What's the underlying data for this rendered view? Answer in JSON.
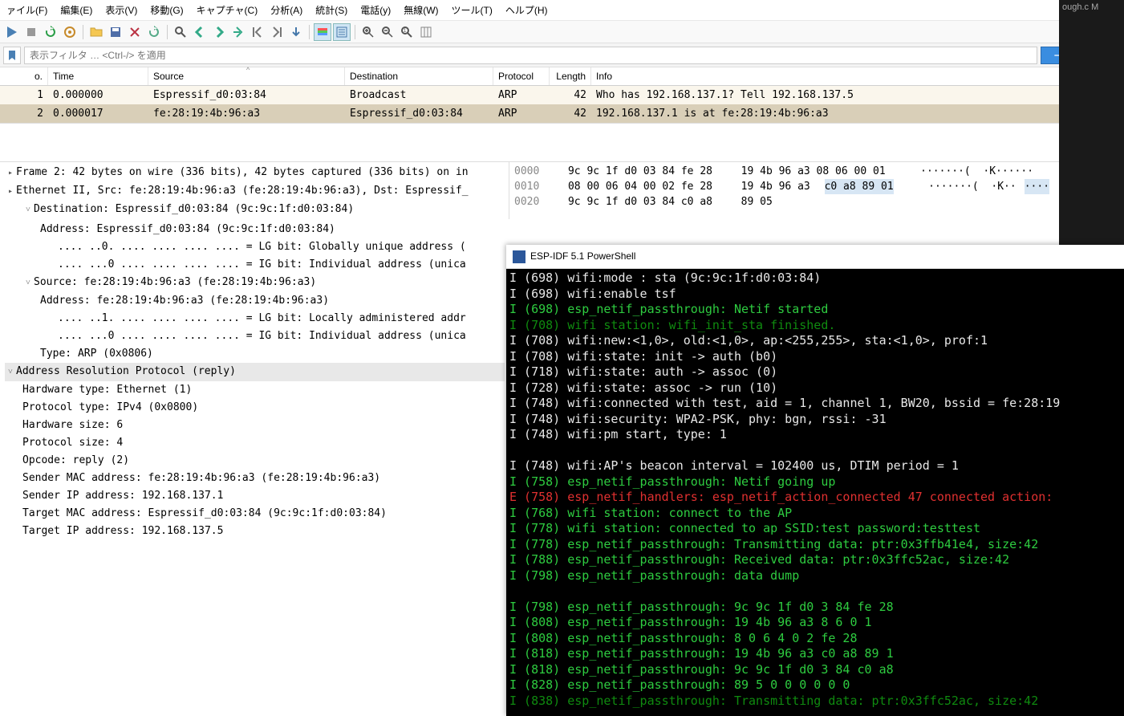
{
  "menu": [
    "ァイル(F)",
    "編集(E)",
    "表示(V)",
    "移動(G)",
    "キャプチャ(C)",
    "分析(A)",
    "統計(S)",
    "電話(y)",
    "無線(W)",
    "ツール(T)",
    "ヘルプ(H)"
  ],
  "filter_placeholder": "表示フィルタ … <Ctrl-/> を適用",
  "table_headers": {
    "no": "o.",
    "time": "Time",
    "source": "Source",
    "destination": "Destination",
    "protocol": "Protocol",
    "length": "Length",
    "info": "Info"
  },
  "packets": [
    {
      "no": "1",
      "time": "0.000000",
      "src": "Espressif_d0:03:84",
      "dst": "Broadcast",
      "prot": "ARP",
      "len": "42",
      "info": "Who has 192.168.137.1? Tell 192.168.137.5"
    },
    {
      "no": "2",
      "time": "0.000017",
      "src": "fe:28:19:4b:96:a3",
      "dst": "Espressif_d0:03:84",
      "prot": "ARP",
      "len": "42",
      "info": "192.168.137.1 is at fe:28:19:4b:96:a3"
    }
  ],
  "details": {
    "frame": "Frame 2: 42 bytes on wire (336 bits), 42 bytes captured (336 bits) on in",
    "eth": "Ethernet II, Src: fe:28:19:4b:96:a3 (fe:28:19:4b:96:a3), Dst: Espressif_",
    "dest_hdr": "Destination: Espressif_d0:03:84 (9c:9c:1f:d0:03:84)",
    "dest_addr": "Address: Espressif_d0:03:84 (9c:9c:1f:d0:03:84)",
    "dest_lg": ".... ..0. .... .... .... .... = LG bit: Globally unique address (",
    "dest_ig": ".... ...0 .... .... .... .... = IG bit: Individual address (unica",
    "src_hdr": "Source: fe:28:19:4b:96:a3 (fe:28:19:4b:96:a3)",
    "src_addr": "Address: fe:28:19:4b:96:a3 (fe:28:19:4b:96:a3)",
    "src_lg": ".... ..1. .... .... .... .... = LG bit: Locally administered addr",
    "src_ig": ".... ...0 .... .... .... .... = IG bit: Individual address (unica",
    "type": "Type: ARP (0x0806)",
    "arp_hdr": "Address Resolution Protocol (reply)",
    "arp": [
      "Hardware type: Ethernet (1)",
      "Protocol type: IPv4 (0x0800)",
      "Hardware size: 6",
      "Protocol size: 4",
      "Opcode: reply (2)",
      "Sender MAC address: fe:28:19:4b:96:a3 (fe:28:19:4b:96:a3)",
      "Sender IP address: 192.168.137.1",
      "Target MAC address: Espressif_d0:03:84 (9c:9c:1f:d0:03:84)",
      "Target IP address: 192.168.137.5"
    ]
  },
  "hex_rows": [
    {
      "off": "0000",
      "b1": "9c 9c 1f d0 03 84 fe 28",
      "b2": "19 4b 96 a3 08 06 00 01",
      "asc": "·······(  ·K······"
    },
    {
      "off": "0010",
      "b1": "08 00 06 04 00 02 fe 28",
      "b2": "19 4b 96 a3 ",
      "b2hi": "c0 a8 89 01",
      "asc": "·······(  ·K··",
      "aschi": "····"
    },
    {
      "off": "0020",
      "b1": "9c 9c 1f d0 03 84 c0 a8",
      "b2": "89 05",
      "asc": ""
    }
  ],
  "ps_title": "ESP-IDF 5.1 PowerShell",
  "ps_lines": [
    {
      "c": "white",
      "t": "I (698) wifi:mode : sta (9c:9c:1f:d0:03:84)"
    },
    {
      "c": "white",
      "t": "I (698) wifi:enable tsf"
    },
    {
      "c": "green",
      "t": "I (698) esp_netif_passthrough: Netif started"
    },
    {
      "c": "dgreen",
      "t": "I (708) wifi station: wifi_init_sta finished."
    },
    {
      "c": "white",
      "t": "I (708) wifi:new:<1,0>, old:<1,0>, ap:<255,255>, sta:<1,0>, prof:1"
    },
    {
      "c": "white",
      "t": "I (708) wifi:state: init -> auth (b0)"
    },
    {
      "c": "white",
      "t": "I (718) wifi:state: auth -> assoc (0)"
    },
    {
      "c": "white",
      "t": "I (728) wifi:state: assoc -> run (10)"
    },
    {
      "c": "white",
      "t": "I (748) wifi:connected with test, aid = 1, channel 1, BW20, bssid = fe:28:19"
    },
    {
      "c": "white",
      "t": "I (748) wifi:security: WPA2-PSK, phy: bgn, rssi: -31"
    },
    {
      "c": "white",
      "t": "I (748) wifi:pm start, type: 1"
    },
    {
      "c": "white",
      "t": ""
    },
    {
      "c": "white",
      "t": "I (748) wifi:AP's beacon interval = 102400 us, DTIM period = 1"
    },
    {
      "c": "green",
      "t": "I (758) esp_netif_passthrough: Netif going up"
    },
    {
      "c": "red",
      "t": "E (758) esp_netif_handlers: esp_netif_action_connected 47 connected action:"
    },
    {
      "c": "green",
      "t": "I (768) wifi station: connect to the AP"
    },
    {
      "c": "green",
      "t": "I (778) wifi station: connected to ap SSID:test password:testtest"
    },
    {
      "c": "green",
      "t": "I (778) esp_netif_passthrough: Transmitting data: ptr:0x3ffb41e4, size:42"
    },
    {
      "c": "green",
      "t": "I (788) esp_netif_passthrough: Received data: ptr:0x3ffc52ac, size:42"
    },
    {
      "c": "green",
      "t": "I (798) esp_netif_passthrough: data dump"
    },
    {
      "c": "white",
      "t": ""
    },
    {
      "c": "green",
      "t": "I (798) esp_netif_passthrough: 9c 9c 1f d0 3 84 fe 28"
    },
    {
      "c": "green",
      "t": "I (808) esp_netif_passthrough: 19 4b 96 a3 8 6 0 1"
    },
    {
      "c": "green",
      "t": "I (808) esp_netif_passthrough: 8 0 6 4 0 2 fe 28"
    },
    {
      "c": "green",
      "t": "I (818) esp_netif_passthrough: 19 4b 96 a3 c0 a8 89 1"
    },
    {
      "c": "green",
      "t": "I (818) esp_netif_passthrough: 9c 9c 1f d0 3 84 c0 a8"
    },
    {
      "c": "green",
      "t": "I (828) esp_netif_passthrough: 89 5 0 0 0 0 0 0"
    },
    {
      "c": "dgreen",
      "t": "I (838) esp_netif_passthrough: Transmitting data: ptr:0x3ffc52ac, size:42"
    }
  ],
  "right_text": "ough.c  M"
}
